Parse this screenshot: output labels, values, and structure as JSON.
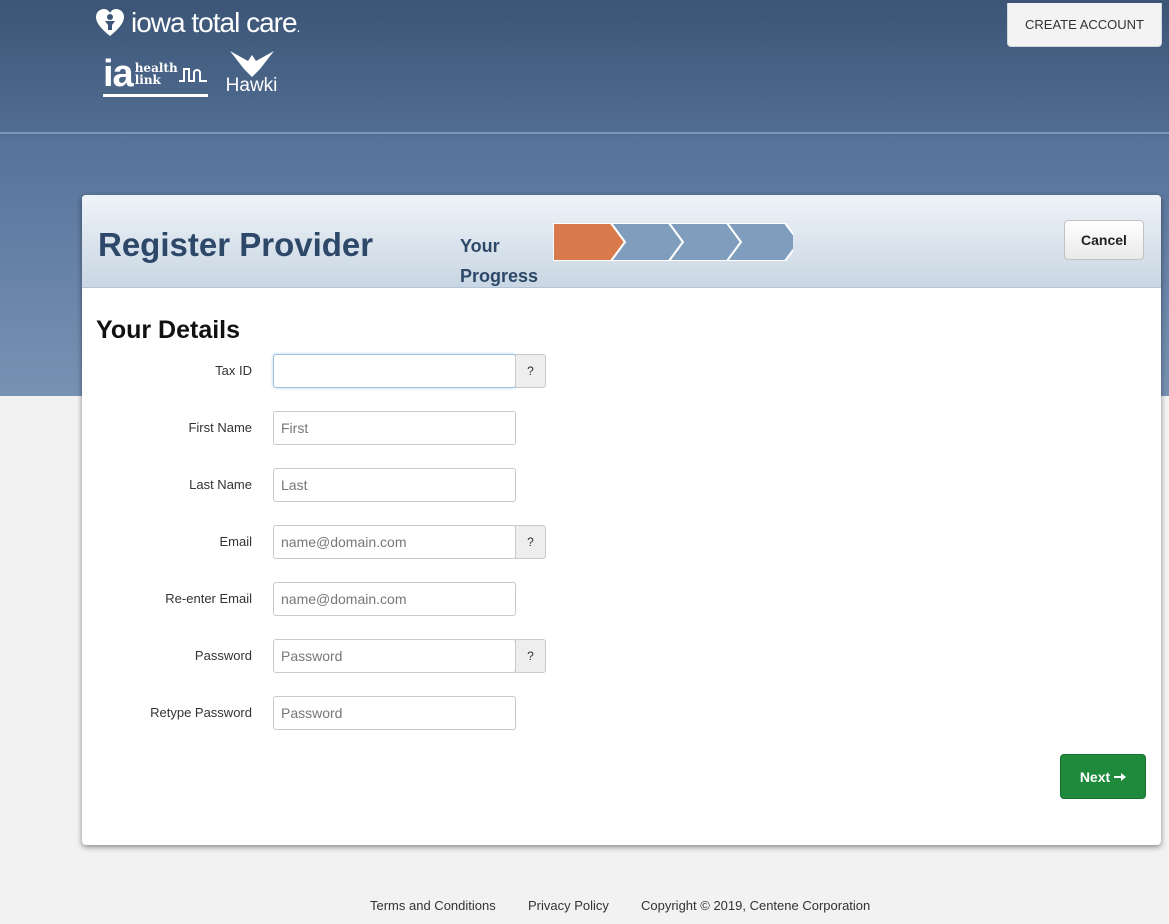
{
  "header": {
    "brand_name": "iowa total care",
    "brand_suffix": ".",
    "ia_logo_big": "ia",
    "ia_logo_line1": "health",
    "ia_logo_line2": "link",
    "hawki_label": "Hawki",
    "create_account": "CREATE ACCOUNT"
  },
  "card": {
    "title": "Register Provider",
    "progress_label_1": "Your",
    "progress_label_2": "Progress",
    "progress": {
      "current_step": 1,
      "total_steps": 4,
      "active_color": "#d97a4c",
      "inactive_color": "#7f9dbd"
    },
    "cancel_label": "Cancel"
  },
  "form": {
    "section_title": "Your Details",
    "help_label": "?",
    "fields": [
      {
        "label": "Tax ID",
        "placeholder": "",
        "value": ""
      },
      {
        "label": "First Name",
        "placeholder": "First",
        "value": ""
      },
      {
        "label": "Last Name",
        "placeholder": "Last",
        "value": ""
      },
      {
        "label": "Email",
        "placeholder": "name@domain.com",
        "value": ""
      },
      {
        "label": "Re-enter Email",
        "placeholder": "name@domain.com",
        "value": ""
      },
      {
        "label": "Password",
        "placeholder": "Password",
        "value": ""
      },
      {
        "label": "Retype Password",
        "placeholder": "Password",
        "value": ""
      }
    ],
    "next_label": "Next",
    "next_icon": "arrow-right-icon"
  },
  "footer": {
    "terms": "Terms and Conditions",
    "privacy": "Privacy Policy",
    "copyright": "Copyright © 2019, Centene Corporation"
  },
  "colors": {
    "header_dark": "#3c5577",
    "header_light": "#7892b4",
    "title_color": "#2d4868",
    "next_button": "#1f8a3b"
  }
}
